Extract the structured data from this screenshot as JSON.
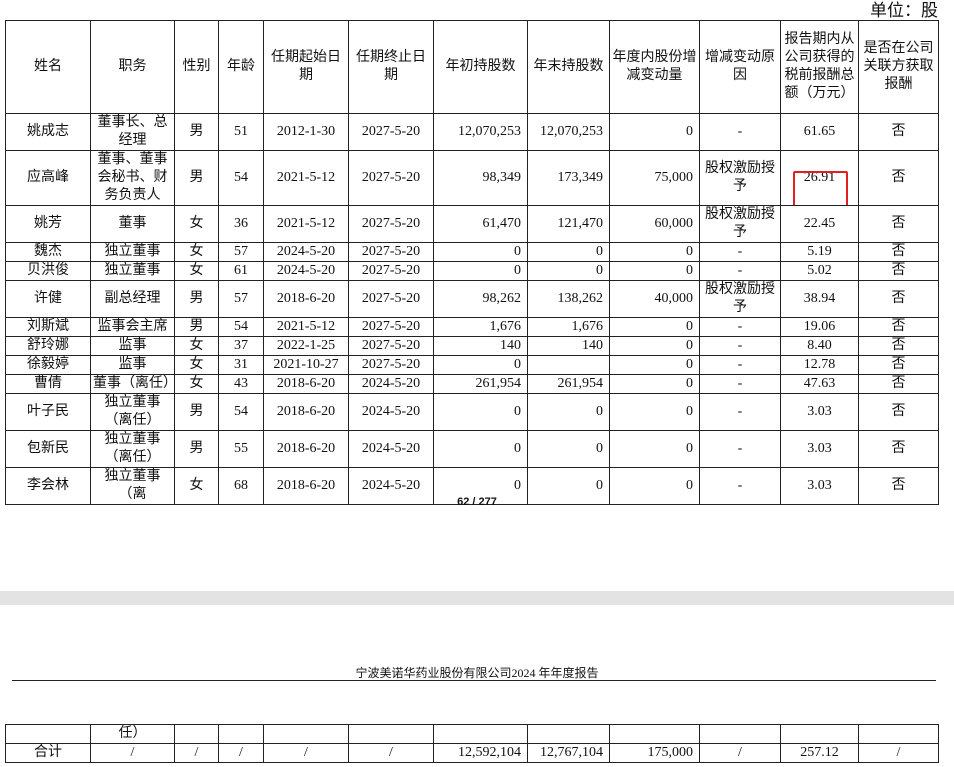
{
  "unit_label": "单位：股",
  "headers": [
    "姓名",
    "职务",
    "性别",
    "年龄",
    "任期起始日期",
    "任期终止日期",
    "年初持股数",
    "年末持股数",
    "年度内股份增减变动量",
    "增减变动原因",
    "报告期内从公司获得的税前报酬总额（万元）",
    "是否在公司关联方获取报酬"
  ],
  "rows": [
    {
      "name": "姚成志",
      "position": "董事长、总经理",
      "gender": "男",
      "age": "51",
      "start": "2012-1-30",
      "end": "2027-5-20",
      "begin_shares": "12,070,253",
      "end_shares": "12,070,253",
      "change": "0",
      "reason": "-",
      "pay": "61.65",
      "related": "否"
    },
    {
      "name": "应高峰",
      "position": "董事、董事会秘书、财务负责人",
      "gender": "男",
      "age": "54",
      "start": "2021-5-12",
      "end": "2027-5-20",
      "begin_shares": "98,349",
      "end_shares": "173,349",
      "change": "75,000",
      "reason": "股权激励授予",
      "pay": "26.91",
      "related": "否"
    },
    {
      "name": "姚芳",
      "position": "董事",
      "gender": "女",
      "age": "36",
      "start": "2021-5-12",
      "end": "2027-5-20",
      "begin_shares": "61,470",
      "end_shares": "121,470",
      "change": "60,000",
      "reason": "股权激励授予",
      "pay": "22.45",
      "related": "否"
    },
    {
      "name": "魏杰",
      "position": "独立董事",
      "gender": "女",
      "age": "57",
      "start": "2024-5-20",
      "end": "2027-5-20",
      "begin_shares": "0",
      "end_shares": "0",
      "change": "0",
      "reason": "-",
      "pay": "5.19",
      "related": "否"
    },
    {
      "name": "贝洪俊",
      "position": "独立董事",
      "gender": "女",
      "age": "61",
      "start": "2024-5-20",
      "end": "2027-5-20",
      "begin_shares": "0",
      "end_shares": "0",
      "change": "0",
      "reason": "-",
      "pay": "5.02",
      "related": "否"
    },
    {
      "name": "许健",
      "position": "副总经理",
      "gender": "男",
      "age": "57",
      "start": "2018-6-20",
      "end": "2027-5-20",
      "begin_shares": "98,262",
      "end_shares": "138,262",
      "change": "40,000",
      "reason": "股权激励授予",
      "pay": "38.94",
      "related": "否"
    },
    {
      "name": "刘斯斌",
      "position": "监事会主席",
      "gender": "男",
      "age": "54",
      "start": "2021-5-12",
      "end": "2027-5-20",
      "begin_shares": "1,676",
      "end_shares": "1,676",
      "change": "0",
      "reason": "-",
      "pay": "19.06",
      "related": "否"
    },
    {
      "name": "舒玲娜",
      "position": "监事",
      "gender": "女",
      "age": "37",
      "start": "2022-1-25",
      "end": "2027-5-20",
      "begin_shares": "140",
      "end_shares": "140",
      "change": "0",
      "reason": "-",
      "pay": "8.40",
      "related": "否"
    },
    {
      "name": "徐毅婷",
      "position": "监事",
      "gender": "女",
      "age": "31",
      "start": "2021-10-27",
      "end": "2027-5-20",
      "begin_shares": "0",
      "end_shares": "",
      "change": "0",
      "reason": "-",
      "pay": "12.78",
      "related": "否"
    },
    {
      "name": "曹倩",
      "position": "董事（离任）",
      "gender": "女",
      "age": "43",
      "start": "2018-6-20",
      "end": "2024-5-20",
      "begin_shares": "261,954",
      "end_shares": "261,954",
      "change": "0",
      "reason": "-",
      "pay": "47.63",
      "related": "否"
    },
    {
      "name": "叶子民",
      "position": "独立董事（离任）",
      "gender": "男",
      "age": "54",
      "start": "2018-6-20",
      "end": "2024-5-20",
      "begin_shares": "0",
      "end_shares": "0",
      "change": "0",
      "reason": "-",
      "pay": "3.03",
      "related": "否"
    },
    {
      "name": "包新民",
      "position": "独立董事（离任）",
      "gender": "男",
      "age": "55",
      "start": "2018-6-20",
      "end": "2024-5-20",
      "begin_shares": "0",
      "end_shares": "0",
      "change": "0",
      "reason": "-",
      "pay": "3.03",
      "related": "否"
    },
    {
      "name": "李会林",
      "position": "独立董事（离",
      "gender": "女",
      "age": "68",
      "start": "2018-6-20",
      "end": "2024-5-20",
      "begin_shares": "0",
      "end_shares": "0",
      "change": "0",
      "reason": "-",
      "pay": "3.03",
      "related": "否"
    }
  ],
  "page_number": "62 / 277",
  "running_header": "宁波美诺华药业股份有限公司2024 年年度报告",
  "continuation": {
    "position_tail": "任）"
  },
  "total": {
    "name": "合计",
    "position": "/",
    "gender": "/",
    "age": "/",
    "start": "/",
    "end": "/",
    "begin_shares": "12,592,104",
    "end_shares": "12,767,104",
    "change": "175,000",
    "reason": "/",
    "pay": "257.12",
    "related": "/"
  },
  "highlight_color": "#e02020"
}
